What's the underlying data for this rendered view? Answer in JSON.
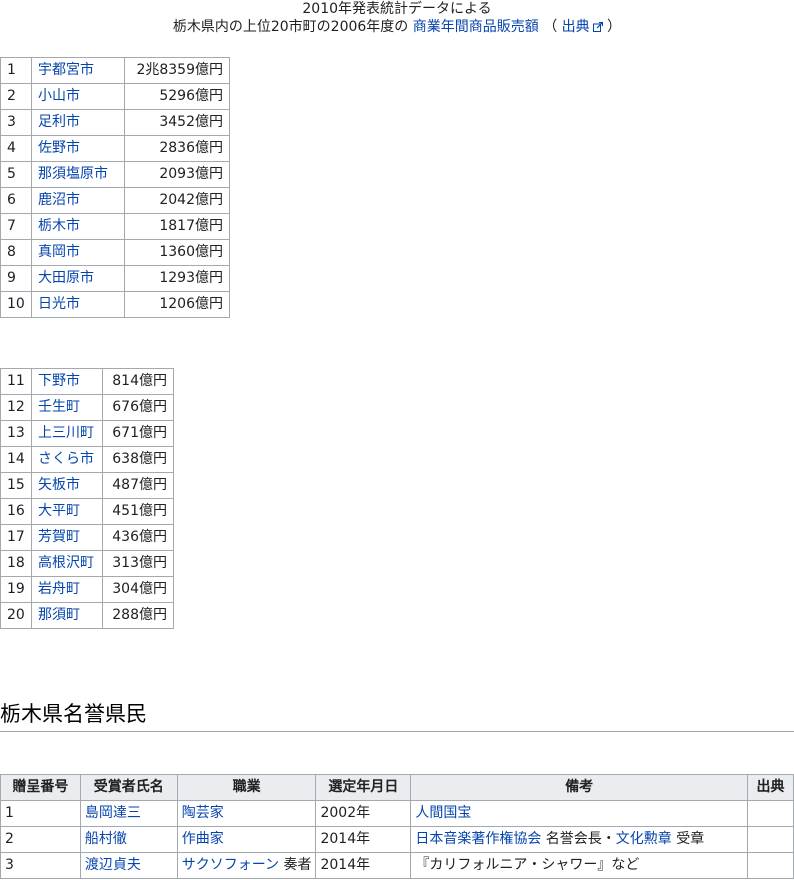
{
  "caption": {
    "line1": "2010年発表統計データによる",
    "line2_prefix": "栃木県内の上位20市町の2006年度の",
    "line2_link": "商業年間商品販売額",
    "paren_open": "（",
    "source_link": "出典",
    "paren_close": "）"
  },
  "ranking_top": [
    {
      "rank": "1",
      "name": "宇都宮市",
      "value": "2兆8359億円"
    },
    {
      "rank": "2",
      "name": "小山市",
      "value": "5296億円"
    },
    {
      "rank": "3",
      "name": "足利市",
      "value": "3452億円"
    },
    {
      "rank": "4",
      "name": "佐野市",
      "value": "2836億円"
    },
    {
      "rank": "5",
      "name": "那須塩原市",
      "value": "2093億円"
    },
    {
      "rank": "6",
      "name": "鹿沼市",
      "value": "2042億円"
    },
    {
      "rank": "7",
      "name": "栃木市",
      "value": "1817億円"
    },
    {
      "rank": "8",
      "name": "真岡市",
      "value": "1360億円"
    },
    {
      "rank": "9",
      "name": "大田原市",
      "value": "1293億円"
    },
    {
      "rank": "10",
      "name": "日光市",
      "value": "1206億円"
    }
  ],
  "ranking_bottom": [
    {
      "rank": "11",
      "name": "下野市",
      "value": "814億円"
    },
    {
      "rank": "12",
      "name": "壬生町",
      "value": "676億円"
    },
    {
      "rank": "13",
      "name": "上三川町",
      "value": "671億円"
    },
    {
      "rank": "14",
      "name": "さくら市",
      "value": "638億円"
    },
    {
      "rank": "15",
      "name": "矢板市",
      "value": "487億円"
    },
    {
      "rank": "16",
      "name": "大平町",
      "value": "451億円"
    },
    {
      "rank": "17",
      "name": "芳賀町",
      "value": "436億円"
    },
    {
      "rank": "18",
      "name": "高根沢町",
      "value": "313億円"
    },
    {
      "rank": "19",
      "name": "岩舟町",
      "value": "304億円"
    },
    {
      "rank": "20",
      "name": "那須町",
      "value": "288億円"
    }
  ],
  "section_heading": "栃木県名誉県民",
  "honor_table": {
    "headers": [
      "贈呈番号",
      "受賞者氏名",
      "職業",
      "選定年月日",
      "備考",
      "出典"
    ],
    "rows": [
      {
        "no": "1",
        "name": "島岡達三",
        "job_link": "陶芸家",
        "job_suffix": "",
        "year": "2002年",
        "note_parts": [
          {
            "text": "人間国宝",
            "link": true
          }
        ],
        "source": ""
      },
      {
        "no": "2",
        "name": "船村徹",
        "job_link": "作曲家",
        "job_suffix": "",
        "year": "2014年",
        "note_parts": [
          {
            "text": "日本音楽著作権協会",
            "link": true
          },
          {
            "text": " 名誉会長・",
            "link": false
          },
          {
            "text": "文化勲章",
            "link": true
          },
          {
            "text": " 受章",
            "link": false
          }
        ],
        "source": ""
      },
      {
        "no": "3",
        "name": "渡辺貞夫",
        "job_link": "サクソフォーン",
        "job_suffix": " 奏者",
        "year": "2014年",
        "note_parts": [
          {
            "text": "『カリフォルニア・シャワー』など",
            "link": false
          }
        ],
        "source": ""
      }
    ]
  },
  "colors": {
    "link": "#0645ad",
    "border": "#a2a9b1",
    "header_bg": "#eaecf0"
  },
  "icons": {
    "external_link": "external-link-icon"
  }
}
